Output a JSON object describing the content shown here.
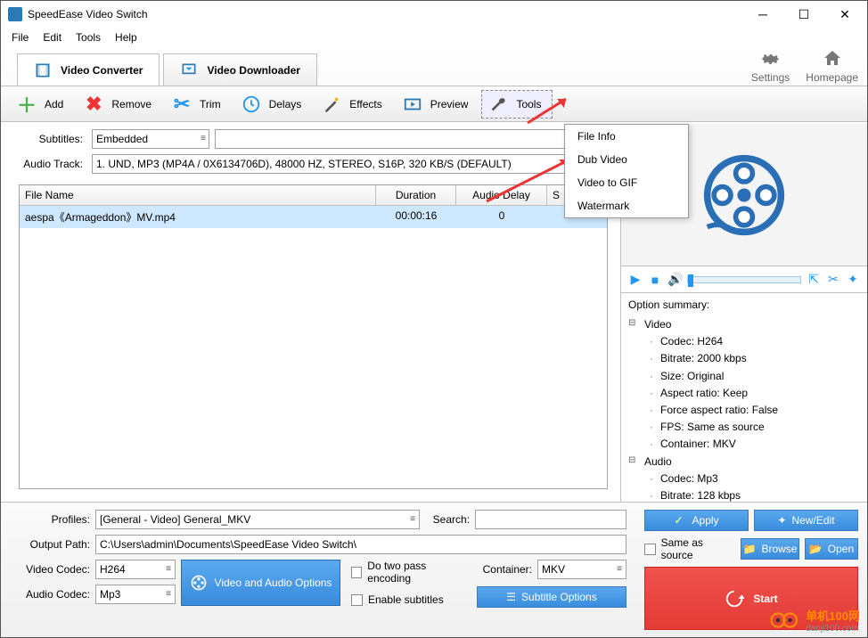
{
  "window": {
    "title": "SpeedEase Video Switch"
  },
  "menu": {
    "file": "File",
    "edit": "Edit",
    "tools": "Tools",
    "help": "Help"
  },
  "tabs": {
    "converter": "Video Converter",
    "downloader": "Video Downloader"
  },
  "top_right": {
    "settings": "Settings",
    "homepage": "Homepage"
  },
  "toolbar": {
    "add": "Add",
    "remove": "Remove",
    "trim": "Trim",
    "delays": "Delays",
    "effects": "Effects",
    "preview": "Preview",
    "tools": "Tools"
  },
  "tools_menu": {
    "file_info": "File Info",
    "dub_video": "Dub Video",
    "video_to_gif": "Video to GIF",
    "watermark": "Watermark"
  },
  "fields": {
    "subtitles_label": "Subtitles:",
    "subtitles_value": "Embedded",
    "audiotrack_label": "Audio Track:",
    "audiotrack_value": "1. UND, MP3 (MP4A / 0X6134706D), 48000 HZ, STEREO, S16P, 320 KB/S (DEFAULT)"
  },
  "grid": {
    "headers": {
      "filename": "File Name",
      "duration": "Duration",
      "audio_delay": "Audio Delay",
      "s": "S"
    },
    "row": {
      "filename": "aespa《Armageddon》MV.mp4",
      "duration": "00:00:16",
      "audio_delay": "0"
    }
  },
  "summary": {
    "label": "Option summary:",
    "video": "Video",
    "v_codec": "Codec: H264",
    "v_bitrate": "Bitrate: 2000 kbps",
    "v_size": "Size:  Original",
    "v_aspect": "Aspect ratio: Keep",
    "v_force": "Force aspect ratio: False",
    "v_fps": "FPS: Same as source",
    "v_container": "Container: MKV",
    "audio": "Audio",
    "a_codec": "Codec: Mp3",
    "a_bitrate": "Bitrate: 128 kbps"
  },
  "bottom": {
    "profiles_label": "Profiles:",
    "profiles_value": "[General - Video] General_MKV",
    "search_label": "Search:",
    "output_label": "Output Path:",
    "output_value": "C:\\Users\\admin\\Documents\\SpeedEase Video Switch\\",
    "vcodec_label": "Video Codec:",
    "vcodec_value": "H264",
    "acodec_label": "Audio Codec:",
    "acodec_value": "Mp3",
    "va_options": "Video and Audio Options",
    "two_pass": "Do two pass encoding",
    "enable_subs": "Enable subtitles",
    "container_label": "Container:",
    "container_value": "MKV",
    "subtitle_options": "Subtitle Options",
    "apply": "Apply",
    "new_edit": "New/Edit",
    "same_as_source": "Same as source",
    "browse": "Browse",
    "open": "Open",
    "start": "Start"
  },
  "watermark": {
    "cn": "单机100网",
    "domain": "danji100.com"
  }
}
